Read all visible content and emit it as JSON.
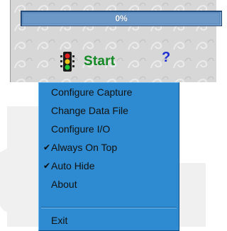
{
  "colors": {
    "panel_bg": "#d7d7d7",
    "progress_bar": "#5f8fc0",
    "start_text": "#138a25",
    "help_icon": "#1f2ed1",
    "menu_bg": "#2e8bd1"
  },
  "progress": {
    "label": "0%",
    "fraction": 0
  },
  "start": {
    "icon": "traffic-light-icon",
    "label": "Start"
  },
  "help": {
    "icon": "help-question-icon",
    "glyph": "?"
  },
  "menu": {
    "items": [
      {
        "label": "Configure Capture",
        "checked": false
      },
      {
        "label": "Change Data File",
        "checked": false
      },
      {
        "label": "Configure I/O",
        "checked": false
      },
      {
        "label": "Always On Top",
        "checked": true
      },
      {
        "label": "Auto Hide",
        "checked": true
      },
      {
        "label": "About",
        "checked": false
      }
    ],
    "exit": {
      "label": "Exit"
    },
    "check_glyph": "✔"
  }
}
